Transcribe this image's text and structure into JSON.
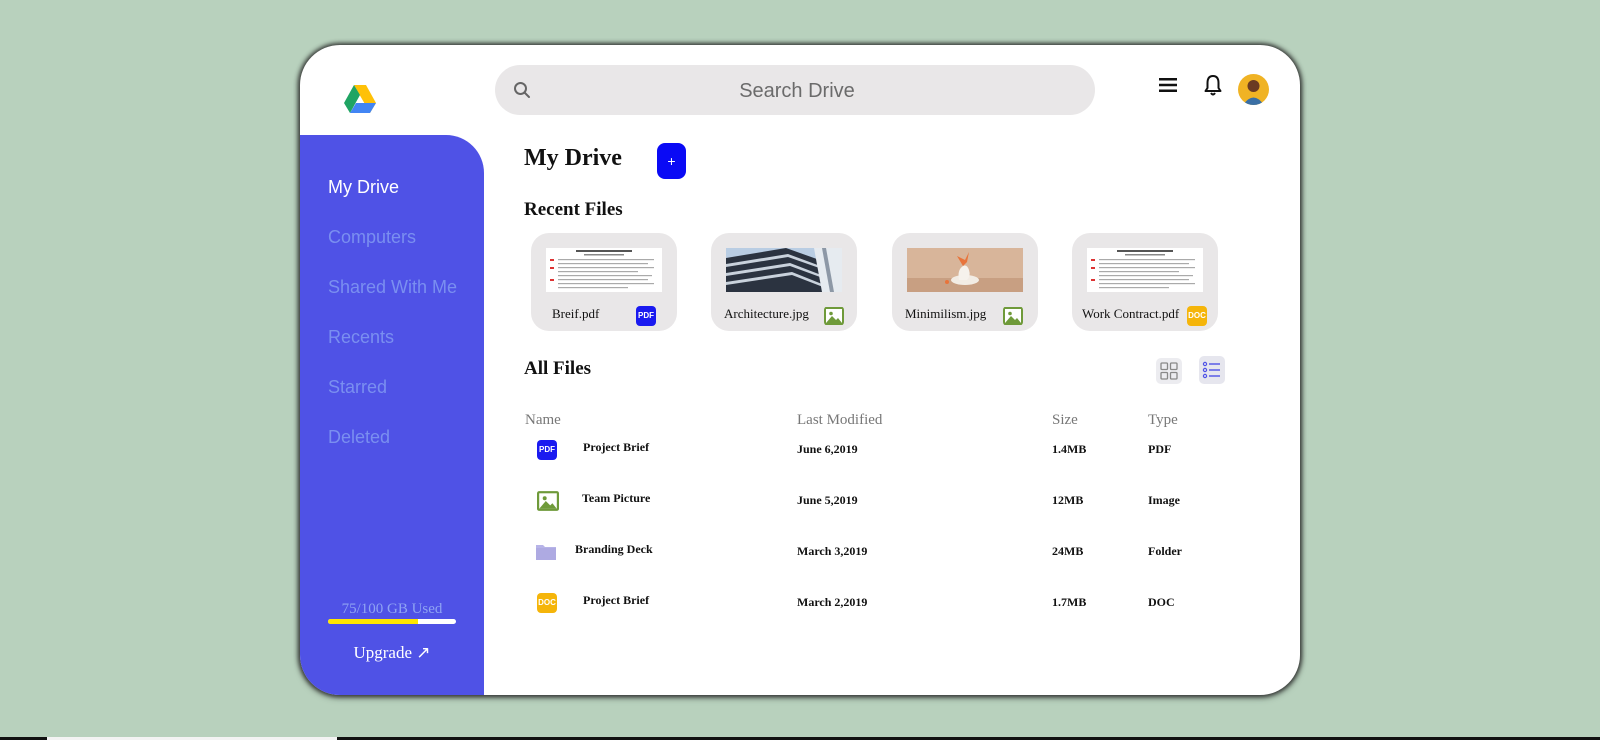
{
  "search": {
    "placeholder": "Search Drive"
  },
  "sidebar": {
    "items": [
      {
        "label": "My Drive",
        "active": true
      },
      {
        "label": "Computers",
        "active": false
      },
      {
        "label": "Shared With Me",
        "active": false
      },
      {
        "label": "Recents",
        "active": false
      },
      {
        "label": "Starred",
        "active": false
      },
      {
        "label": "Deleted",
        "active": false
      }
    ],
    "storage_text": "75/100 GB Used",
    "storage_used_fraction": 0.7,
    "upgrade_label": "Upgrade ↗"
  },
  "main": {
    "title": "My Drive",
    "add_label": "+",
    "recent_title": "Recent Files",
    "recent_files": [
      {
        "name": "Breif.pdf",
        "badge": "PDF",
        "thumb": "document"
      },
      {
        "name": "Architecture.jpg",
        "badge": "image-icon",
        "thumb": "building"
      },
      {
        "name": "Minimilism.jpg",
        "badge": "image-icon",
        "thumb": "vase"
      },
      {
        "name": "Work Contract.pdf",
        "badge": "DOC",
        "thumb": "document"
      }
    ],
    "all_files_title": "All Files",
    "columns": {
      "name": "Name",
      "modified": "Last Modified",
      "size": "Size",
      "type": "Type"
    },
    "rows": [
      {
        "name": "Project Brief",
        "modified": "June 6,2019",
        "size": "1.4MB",
        "type": "PDF",
        "icon": "pdf-icon",
        "badge": "PDF"
      },
      {
        "name": "Team Picture",
        "modified": "June 5,2019",
        "size": "12MB",
        "type": "Image",
        "icon": "image-icon",
        "badge": ""
      },
      {
        "name": "Branding Deck",
        "modified": "March 3,2019",
        "size": "24MB",
        "type": "Folder",
        "icon": "folder-icon",
        "badge": ""
      },
      {
        "name": "Project Brief",
        "modified": "March 2,2019",
        "size": "1.7MB",
        "type": "DOC",
        "icon": "doc-icon",
        "badge": "DOC"
      }
    ]
  },
  "colors": {
    "sidebar": "#4f52e6",
    "accent_blue": "#0a0af5",
    "pdf_badge": "#1a1af0",
    "doc_badge": "#f5b50a",
    "image_green": "#6f9a3a",
    "folder": "#b7b4e8",
    "storage_fill": "#ffe600"
  }
}
